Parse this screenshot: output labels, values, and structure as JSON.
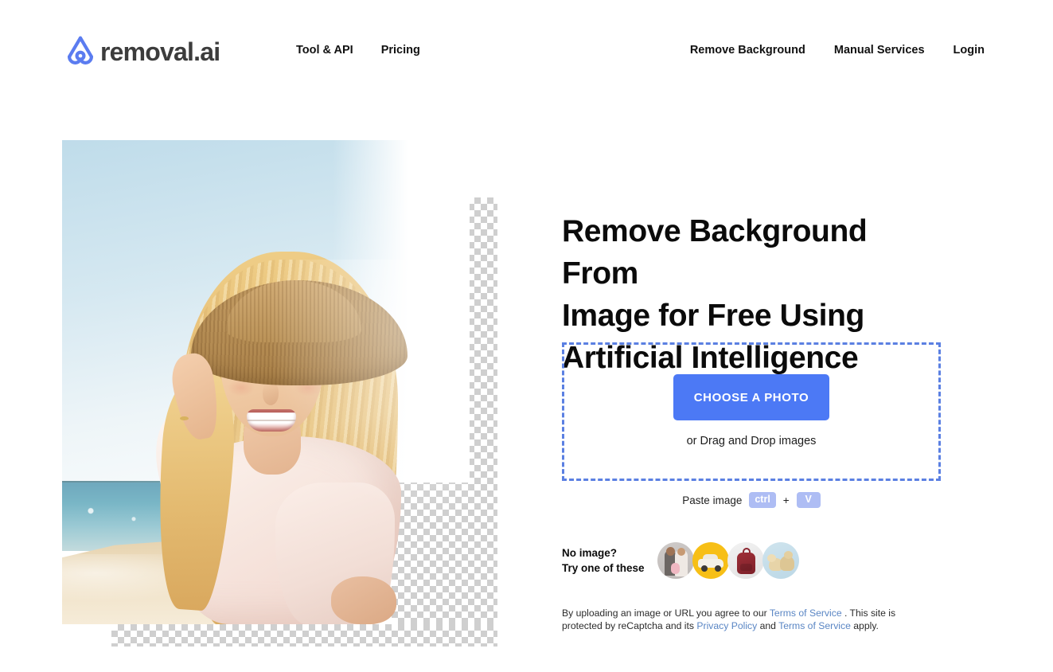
{
  "site": {
    "brand_name": "removal.ai",
    "logo_icon": "removal-ai-logo-icon",
    "accent_blue": "#4c79f5",
    "dashed_border_blue": "#5b80e2",
    "kbd_badge_blue": "#aebdf4",
    "link_blue": "#5a86c4"
  },
  "nav": {
    "left_items": [
      {
        "label": "Tool & API"
      },
      {
        "label": "Pricing"
      }
    ],
    "right_items": [
      {
        "label": "Remove Background"
      },
      {
        "label": "Manual Services"
      },
      {
        "label": "Login"
      }
    ]
  },
  "hero": {
    "image_alt": "smiling blonde woman in straw hat on beach with background partly removed",
    "transparency_pattern": "checkerboard"
  },
  "main": {
    "headline_line1": "Remove Background From",
    "headline_line2": "Image for Free Using",
    "headline_line3": "Artificial Intelligence",
    "dropzone": {
      "button_label": "CHOOSE A PHOTO",
      "drag_text": "or Drag and Drop images"
    },
    "paste": {
      "label": "Paste image",
      "key1": "ctrl",
      "plus": "+",
      "key2": "V"
    },
    "samples": {
      "label_line1": "No image?",
      "label_line2": "Try one of these",
      "thumbs": [
        {
          "name": "sample-family"
        },
        {
          "name": "sample-car"
        },
        {
          "name": "sample-backpack"
        },
        {
          "name": "sample-dogs"
        }
      ]
    },
    "legal": {
      "part1": "By uploading an image or URL you agree to our ",
      "link1": "Terms of Service",
      "part2": " . This site is protected by reCaptcha and its ",
      "link2": "Privacy Policy",
      "part3": " and ",
      "link3": "Terms of Service",
      "part4": " apply."
    }
  }
}
